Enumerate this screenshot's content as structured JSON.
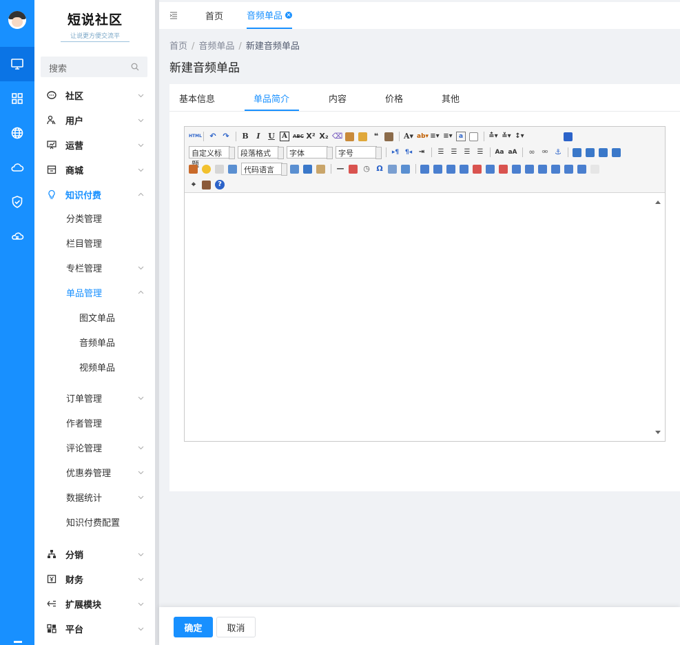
{
  "brand": {
    "title": "短说社区",
    "slogan": "让说更方便交流平"
  },
  "search": {
    "placeholder": "搜索"
  },
  "rail": {
    "items": [
      "monitor-icon",
      "grid-icon",
      "globe-icon",
      "cloud-icon",
      "shield-check-icon",
      "cloud-api-icon"
    ]
  },
  "sidebar": {
    "menus": [
      {
        "label": "社区",
        "icon": "chat-icon"
      },
      {
        "label": "用户",
        "icon": "users-icon"
      },
      {
        "label": "运营",
        "icon": "presentation-icon"
      },
      {
        "label": "商城",
        "icon": "store-icon"
      },
      {
        "label": "知识付费",
        "icon": "bulb-icon"
      }
    ],
    "knowledge_subs": [
      "分类管理",
      "栏目管理",
      "专栏管理",
      "单品管理"
    ],
    "product_subs": [
      "图文单品",
      "音频单品",
      "视频单品"
    ],
    "knowledge_subs2": [
      "订单管理",
      "作者管理",
      "评论管理",
      "优惠券管理",
      "数据统计",
      "知识付费配置"
    ],
    "bottom_menus": [
      {
        "label": "分销",
        "icon": "tree-icon"
      },
      {
        "label": "财务",
        "icon": "finance-icon"
      },
      {
        "label": "扩展模块",
        "icon": "extend-icon"
      },
      {
        "label": "平台",
        "icon": "platform-icon"
      }
    ]
  },
  "topbar": {
    "tabs": [
      "首页",
      "音频单品"
    ]
  },
  "breadcrumb": {
    "items": [
      "首页",
      "音频单品",
      "新建音频单品"
    ]
  },
  "page": {
    "title": "新建音频单品"
  },
  "form_tabs": [
    "基本信息",
    "单品简介",
    "内容",
    "价格",
    "其他"
  ],
  "editor": {
    "selects": [
      "自定义标题",
      "段落格式",
      "字体",
      "字号",
      "代码语言"
    ]
  },
  "footer": {
    "ok": "确定",
    "cancel": "取消"
  },
  "colors": {
    "primary": "#1890ff",
    "rail": "#1890ff"
  }
}
